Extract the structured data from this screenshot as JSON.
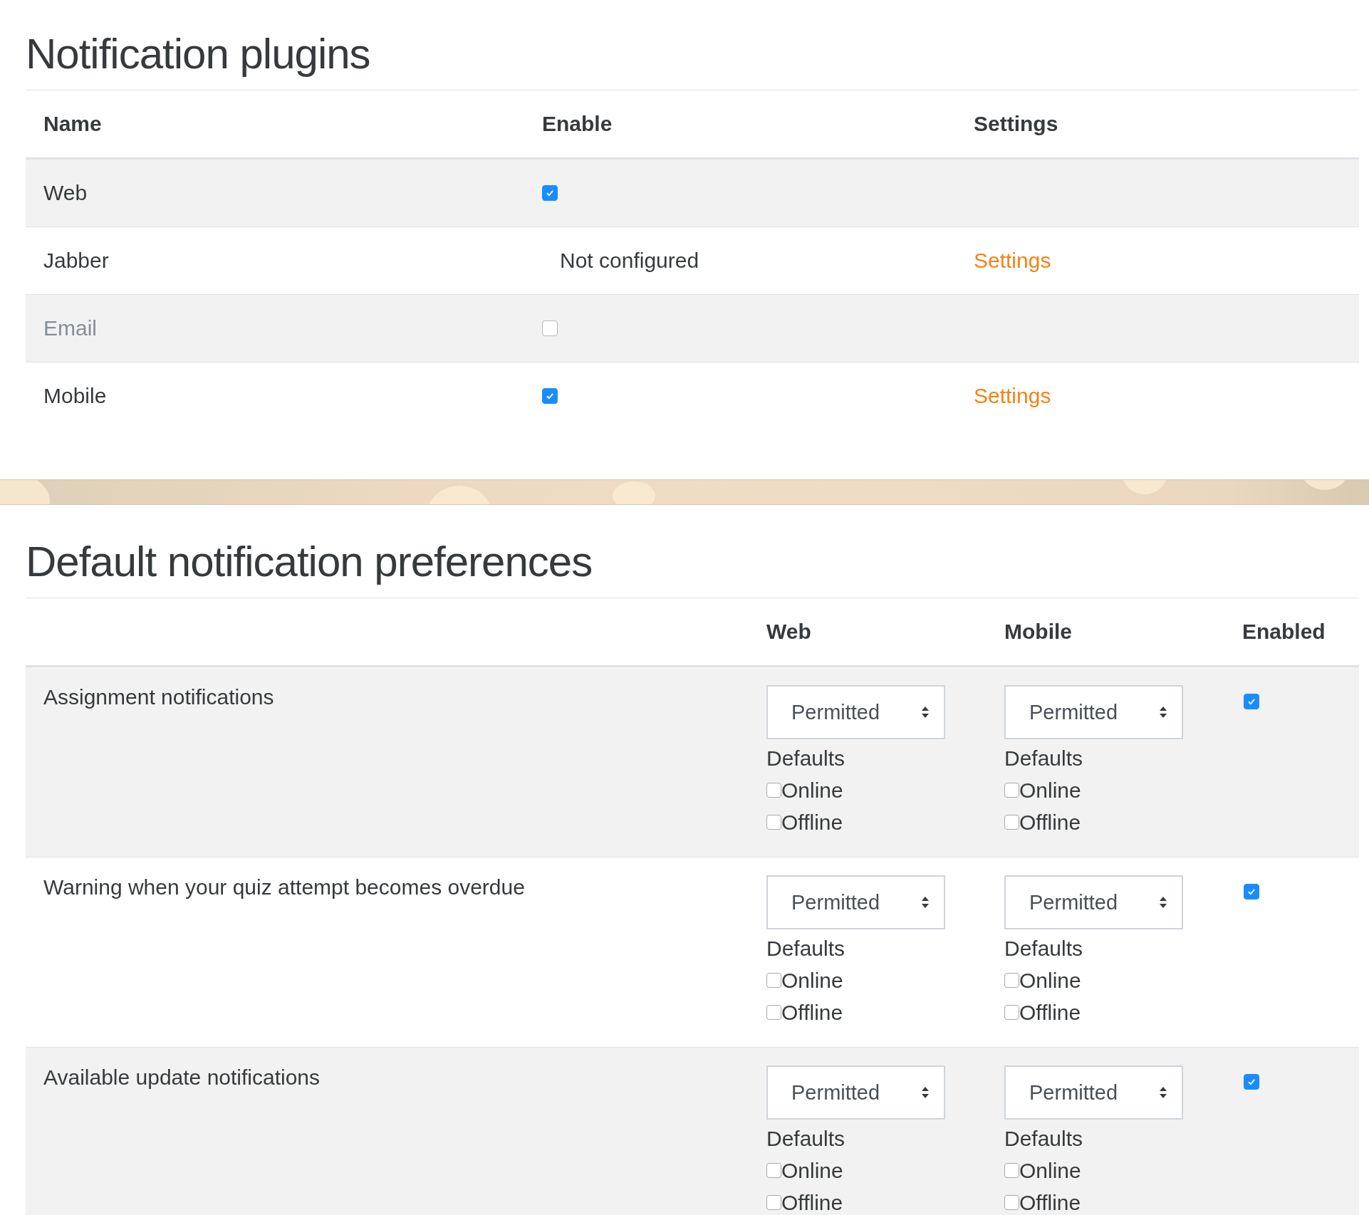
{
  "plugins": {
    "title": "Notification plugins",
    "columns": [
      "Name",
      "Enable",
      "Settings"
    ],
    "rows": [
      {
        "name": "Web",
        "disabled": false,
        "enable": {
          "kind": "checkbox",
          "checked": true
        },
        "settings": null
      },
      {
        "name": "Jabber",
        "disabled": false,
        "enable": {
          "kind": "text",
          "text": "Not configured"
        },
        "settings": "Settings"
      },
      {
        "name": "Email",
        "disabled": true,
        "enable": {
          "kind": "checkbox",
          "checked": false
        },
        "settings": null
      },
      {
        "name": "Mobile",
        "disabled": false,
        "enable": {
          "kind": "checkbox",
          "checked": true
        },
        "settings": "Settings"
      }
    ]
  },
  "preferences": {
    "title": "Default notification preferences",
    "columns": [
      "Web",
      "Mobile",
      "Enabled"
    ],
    "rows": [
      {
        "name": "Assignment notifications",
        "enabled": true,
        "outputs": [
          {
            "select": "Permitted",
            "defaults_label": "Defaults",
            "online": {
              "label": "Online",
              "checked": false
            },
            "offline": {
              "label": "Offline",
              "checked": false
            }
          },
          {
            "select": "Permitted",
            "defaults_label": "Defaults",
            "online": {
              "label": "Online",
              "checked": false
            },
            "offline": {
              "label": "Offline",
              "checked": false
            }
          }
        ]
      },
      {
        "name": "Warning when your quiz attempt becomes overdue",
        "enabled": true,
        "outputs": [
          {
            "select": "Permitted",
            "defaults_label": "Defaults",
            "online": {
              "label": "Online",
              "checked": false
            },
            "offline": {
              "label": "Offline",
              "checked": false
            }
          },
          {
            "select": "Permitted",
            "defaults_label": "Defaults",
            "online": {
              "label": "Online",
              "checked": false
            },
            "offline": {
              "label": "Offline",
              "checked": false
            }
          }
        ]
      },
      {
        "name": "Available update notifications",
        "enabled": true,
        "outputs": [
          {
            "select": "Permitted",
            "defaults_label": "Defaults",
            "online": {
              "label": "Online",
              "checked": false
            },
            "offline": {
              "label": "Offline",
              "checked": false
            }
          },
          {
            "select": "Permitted",
            "defaults_label": "Defaults",
            "online": {
              "label": "Online",
              "checked": false
            },
            "offline": {
              "label": "Offline",
              "checked": false
            }
          }
        ]
      }
    ]
  }
}
